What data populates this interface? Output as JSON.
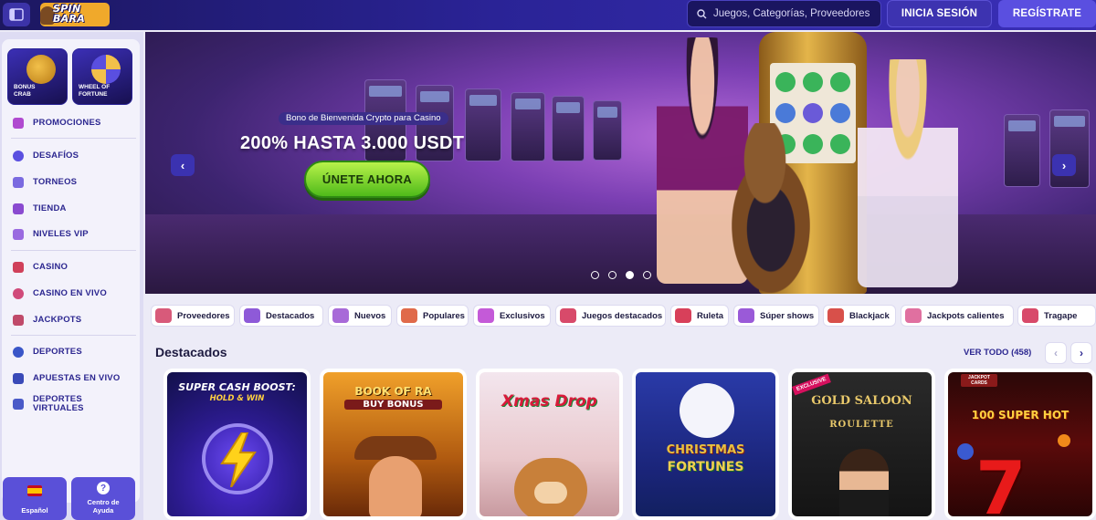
{
  "header": {
    "logo_text": "SPIN BARA",
    "search_placeholder": "Juegos, Categorías, Proveedores",
    "login_label": "INICIA SESIÓN",
    "register_label": "REGÍSTRATE"
  },
  "sidebar": {
    "promo_tiles": [
      {
        "label": "BONUS CRAB"
      },
      {
        "label": "WHEEL OF FORTUNE"
      }
    ],
    "items": [
      {
        "label": "PROMOCIONES",
        "icon": "gift-icon"
      },
      {
        "label": "DESAFÍOS",
        "icon": "target-icon"
      },
      {
        "label": "TORNEOS",
        "icon": "trophy-icon"
      },
      {
        "label": "TIENDA",
        "icon": "store-icon"
      },
      {
        "label": "NIVELES VIP",
        "icon": "crown-icon"
      },
      {
        "label": "CASINO",
        "icon": "slot-icon"
      },
      {
        "label": "CASINO EN VIVO",
        "icon": "chip-icon"
      },
      {
        "label": "JACKPOTS",
        "icon": "dice-icon"
      },
      {
        "label": "DEPORTES",
        "icon": "ball-icon"
      },
      {
        "label": "APUESTAS EN VIVO",
        "icon": "live-icon"
      },
      {
        "label": "DEPORTES VIRTUALES",
        "icon": "virtual-icon"
      }
    ],
    "language_label": "Español",
    "help_label": "Centro de Ayuda"
  },
  "hero": {
    "badge": "Bono de Bienvenida Crypto para Casino",
    "title": "200% HASTA 3.000 USDT",
    "cta": "ÚNETE AHORA",
    "slides_total": 4,
    "active_slide": 3
  },
  "categories": [
    {
      "label": "Proveedores",
      "color": "#d85a7a"
    },
    {
      "label": "Destacados",
      "color": "#8e5ad8"
    },
    {
      "label": "Nuevos",
      "color": "#a86ad8"
    },
    {
      "label": "Populares",
      "color": "#e06a4a"
    },
    {
      "label": "Exclusivos",
      "color": "#c45ad8"
    },
    {
      "label": "Juegos destacados",
      "color": "#d84a6a"
    },
    {
      "label": "Ruleta",
      "color": "#d8405a"
    },
    {
      "label": "Súper shows",
      "color": "#9a5ad8"
    },
    {
      "label": "Blackjack",
      "color": "#d8504a"
    },
    {
      "label": "Jackpots calientes",
      "color": "#e070a0"
    },
    {
      "label": "Tragape",
      "color": "#d84a6a"
    }
  ],
  "featured": {
    "title": "Destacados",
    "view_all": "VER TODO (458)",
    "games": [
      {
        "title": "SUPER CASH BOOST:",
        "subtitle": "HOLD & WIN"
      },
      {
        "title": "BOOK OF RA",
        "subtitle": "BUY BONUS"
      },
      {
        "title": "Xmas Drop",
        "subtitle": ""
      },
      {
        "title": "CHRISTMAS",
        "subtitle": "FORTUNES"
      },
      {
        "title": "GOLD SALOON",
        "subtitle": "ROULETTE",
        "badge": "EXCLUSIVE"
      },
      {
        "title": "100 SUPER HOT",
        "subtitle": "",
        "badge": "JACKPOT CARDS"
      }
    ]
  }
}
